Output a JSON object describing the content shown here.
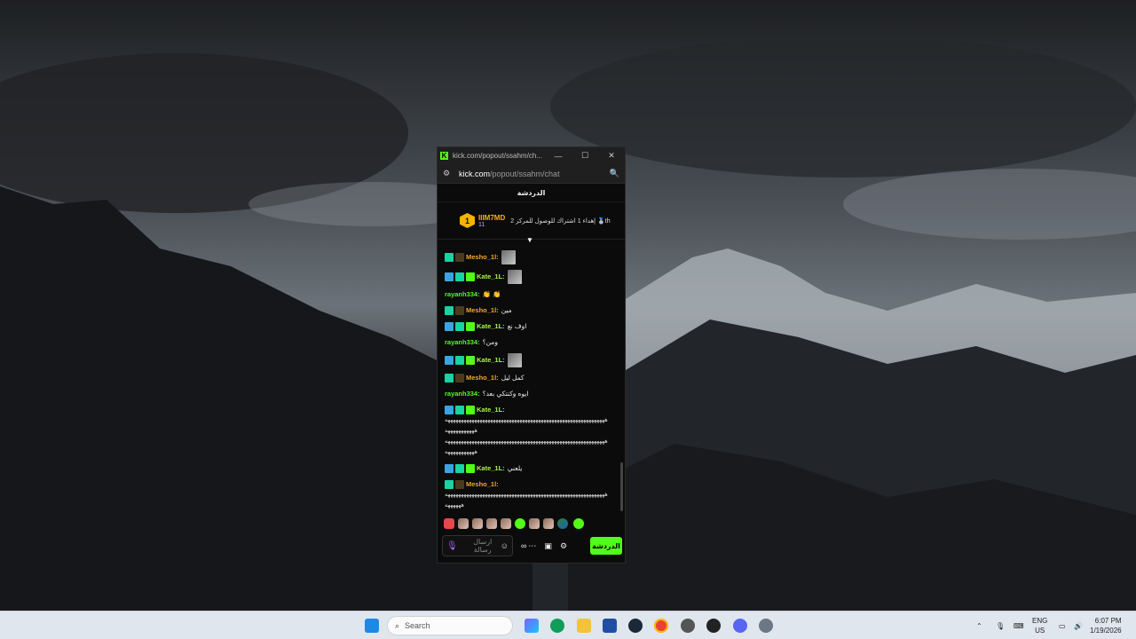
{
  "window": {
    "title": "kick.com/popout/ssahm/ch...",
    "controls": {
      "minimize": "—",
      "maximize": "☐",
      "close": "✕"
    }
  },
  "urlbar": {
    "host": "kick.com",
    "path": "/popout/ssahm/chat"
  },
  "chat": {
    "header": "الدردشة",
    "pinned": {
      "rank": "1",
      "username": "IIIM7MD",
      "count": "11",
      "text": "إهداء 1 اشتراك للوصول للمركز 2 🥈th"
    },
    "messages": [
      {
        "user": "Mesho_1l:",
        "text": "",
        "thumb": true,
        "color": "orange",
        "badges": [
          "og",
          "sub"
        ]
      },
      {
        "user": "Kate_1L:",
        "text": "",
        "thumb": true,
        "color": "lime",
        "badges": [
          "blue",
          "og",
          "green"
        ]
      },
      {
        "user": "rayanh334:",
        "text": "👏 👏",
        "thumb": false,
        "color": "green",
        "badges": []
      },
      {
        "user": "Mesho_1l:",
        "text": "مين",
        "thumb": false,
        "color": "orange",
        "badges": [
          "og",
          "sub"
        ]
      },
      {
        "user": "Kate_1L:",
        "text": "اوف نع",
        "thumb": false,
        "color": "lime",
        "badges": [
          "blue",
          "og",
          "green"
        ]
      },
      {
        "user": "rayanh334:",
        "text": "ومن؟",
        "thumb": false,
        "color": "green",
        "badges": []
      },
      {
        "user": "Kate_1L:",
        "text": "",
        "thumb": true,
        "color": "lime",
        "badges": [
          "blue",
          "og",
          "green"
        ]
      },
      {
        "user": "Mesho_1l:",
        "text": "كمل ليل",
        "thumb": false,
        "color": "orange",
        "badges": [
          "og",
          "sub"
        ]
      },
      {
        "user": "rayanh334:",
        "text": "ايوه وكنتكي بعد؟",
        "thumb": false,
        "color": "green",
        "badges": []
      },
      {
        "user": "Kate_1L:",
        "text": "",
        "thumb": false,
        "color": "lime",
        "badges": [
          "blue",
          "og",
          "green"
        ],
        "long": [
          "ههههههههههههههههههههههههههههههههههههههههههههههههههههههههههههه",
          "هههههههههههه",
          "ههههههههههههههههههههههههههههههههههههههههههههههههههههههههههههه",
          "هههههههههههه"
        ]
      },
      {
        "user": "Kate_1L:",
        "text": "يلعني",
        "thumb": false,
        "color": "lime",
        "badges": [
          "blue",
          "og",
          "green"
        ]
      },
      {
        "user": "Mesho_1l:",
        "text": "",
        "thumb": false,
        "color": "orange",
        "badges": [
          "og",
          "sub"
        ],
        "long": [
          "ههههههههههههههههههههههههههههههههههههههههههههههههههههههههههههه",
          "ههههههه"
        ]
      }
    ],
    "input": {
      "placeholder": "ارسال رسالة"
    },
    "send_label": "الدردشة"
  },
  "taskbar": {
    "search_placeholder": "Search",
    "lang_top": "ENG",
    "lang_bottom": "US",
    "time": "6:07 PM",
    "date": "1/19/2026"
  }
}
